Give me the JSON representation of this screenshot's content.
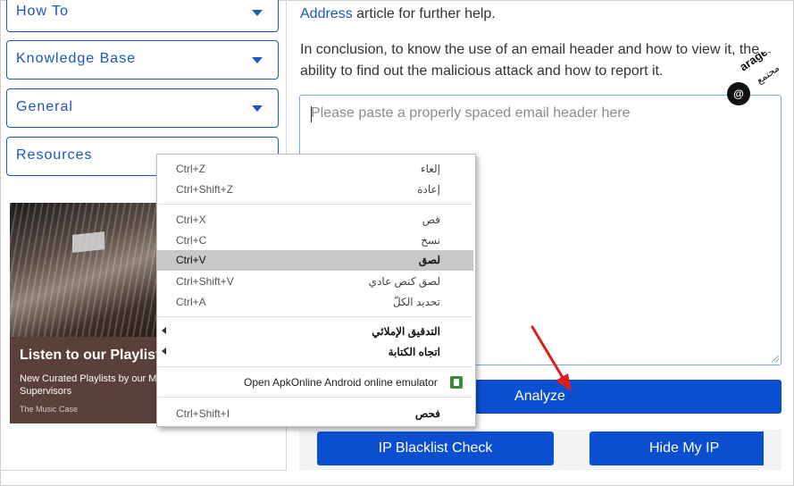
{
  "sidebar": {
    "accordions": [
      {
        "label": "How To"
      },
      {
        "label": "Knowledge Base"
      },
      {
        "label": "General"
      },
      {
        "label": "Resources"
      }
    ],
    "ad": {
      "headline": "Listen to our Playlist",
      "sub": "New Curated Playlists by our Music Supervisors",
      "brand": "The Music Case"
    }
  },
  "article": {
    "link_text": "Address",
    "line1_rest": " article for further help.",
    "conclusion": "In conclusion, to know the use of an email header and how to view it, the ability to find out the malicious attack and how to report it."
  },
  "header_input": {
    "placeholder": "Please paste a properly spaced email header here"
  },
  "buttons": {
    "analyze": "Analyze",
    "blacklist": "IP Blacklist Check",
    "hide_ip": "Hide My IP"
  },
  "watermark": {
    "text": "arageek",
    "sub": "مجتمع"
  },
  "context_menu": {
    "undo": {
      "shortcut": "Ctrl+Z",
      "label": "إلغاء"
    },
    "redo": {
      "shortcut": "Ctrl+Shift+Z",
      "label": "إعادة"
    },
    "cut": {
      "shortcut": "Ctrl+X",
      "label": "قص"
    },
    "copy": {
      "shortcut": "Ctrl+C",
      "label": "نسخ"
    },
    "paste": {
      "shortcut": "Ctrl+V",
      "label": "لصق"
    },
    "paste_plain": {
      "shortcut": "Ctrl+Shift+V",
      "label": "لصق كنص عادي"
    },
    "select_all": {
      "shortcut": "Ctrl+A",
      "label": "تحديد الكلّ"
    },
    "spellcheck": {
      "label": "التدقيق الإملائي"
    },
    "writing_direction": {
      "label": "اتجاه الكتابة"
    },
    "extension": {
      "label": "Open ApkOnline Android online emulator"
    },
    "inspect": {
      "shortcut": "Ctrl+Shift+I",
      "label": "فحص"
    }
  },
  "colors": {
    "primary": "#0b4fd0",
    "link": "#1a56c4",
    "annotation_arrow": "#e11b1b"
  }
}
